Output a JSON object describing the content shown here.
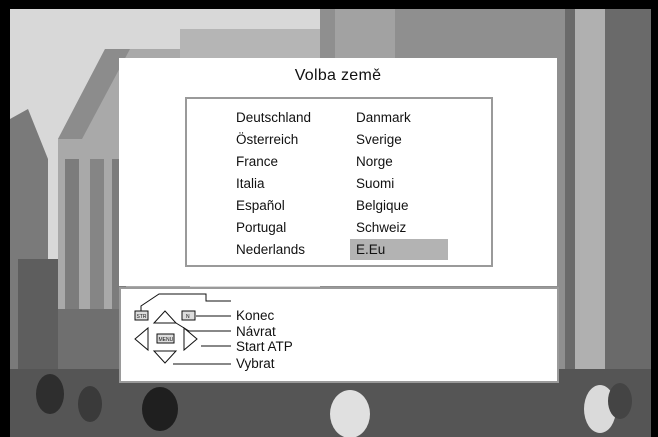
{
  "dialog": {
    "title": "Volba země"
  },
  "countries": {
    "column1": [
      "Deutschland",
      "Österreich",
      "France",
      "Italia",
      "Español",
      "Portugal",
      "Nederlands"
    ],
    "column2": [
      "Danmark",
      "Sverige",
      "Norge",
      "Suomi",
      "Belgique",
      "Schweiz",
      "E.Eu"
    ],
    "selected": "E.Eu"
  },
  "legend": {
    "keys": {
      "str": "STR",
      "n": "N",
      "menu": "MENU"
    },
    "items": [
      "Konec",
      "Návrat",
      "Start ATP",
      "Vybrat"
    ]
  },
  "colors": {
    "highlight": "#b3b3b3",
    "panel": "#ffffff",
    "border": "#9a9a9a"
  }
}
